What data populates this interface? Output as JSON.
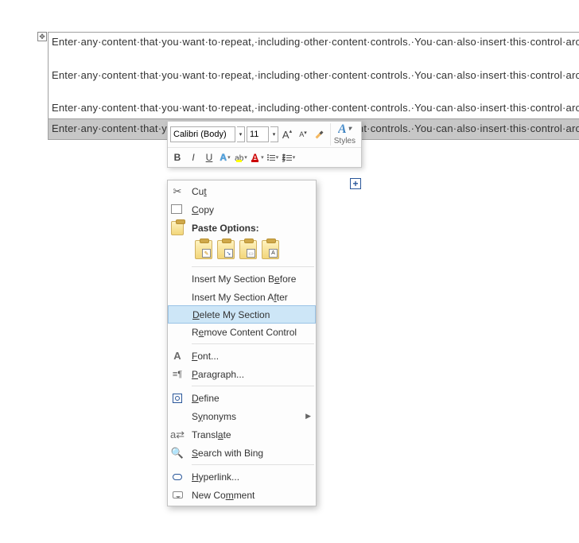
{
  "table_handle_glyph": "✥",
  "add_handle_glyph": "+",
  "paragraph_text": "Enter·any·content·that·you·want·to·repeat,·including·other·content·controls.·You·can·also·insert·this·control·around·table·rows·in·order·to·repeat·parts·of·a·table.¶",
  "mini_toolbar": {
    "font_name": "Calibri (Body)",
    "font_size": "11",
    "styles_label": "Styles",
    "grow_font": "A",
    "shrink_font": "A",
    "bold": "B",
    "italic": "I",
    "underline": "U"
  },
  "context_menu": {
    "cut": "Cut",
    "copy": "Copy",
    "paste_options": "Paste Options:",
    "insert_before": "Insert My Section Before",
    "insert_after": "Insert My Section After",
    "delete_section": "Delete My Section",
    "remove_cc": "Remove Content Control",
    "font": "Font...",
    "paragraph": "Paragraph...",
    "define": "Define",
    "synonyms": "Synonyms",
    "translate": "Translate",
    "search_bing": "Search with Bing",
    "hyperlink": "Hyperlink...",
    "new_comment": "New Comment"
  }
}
